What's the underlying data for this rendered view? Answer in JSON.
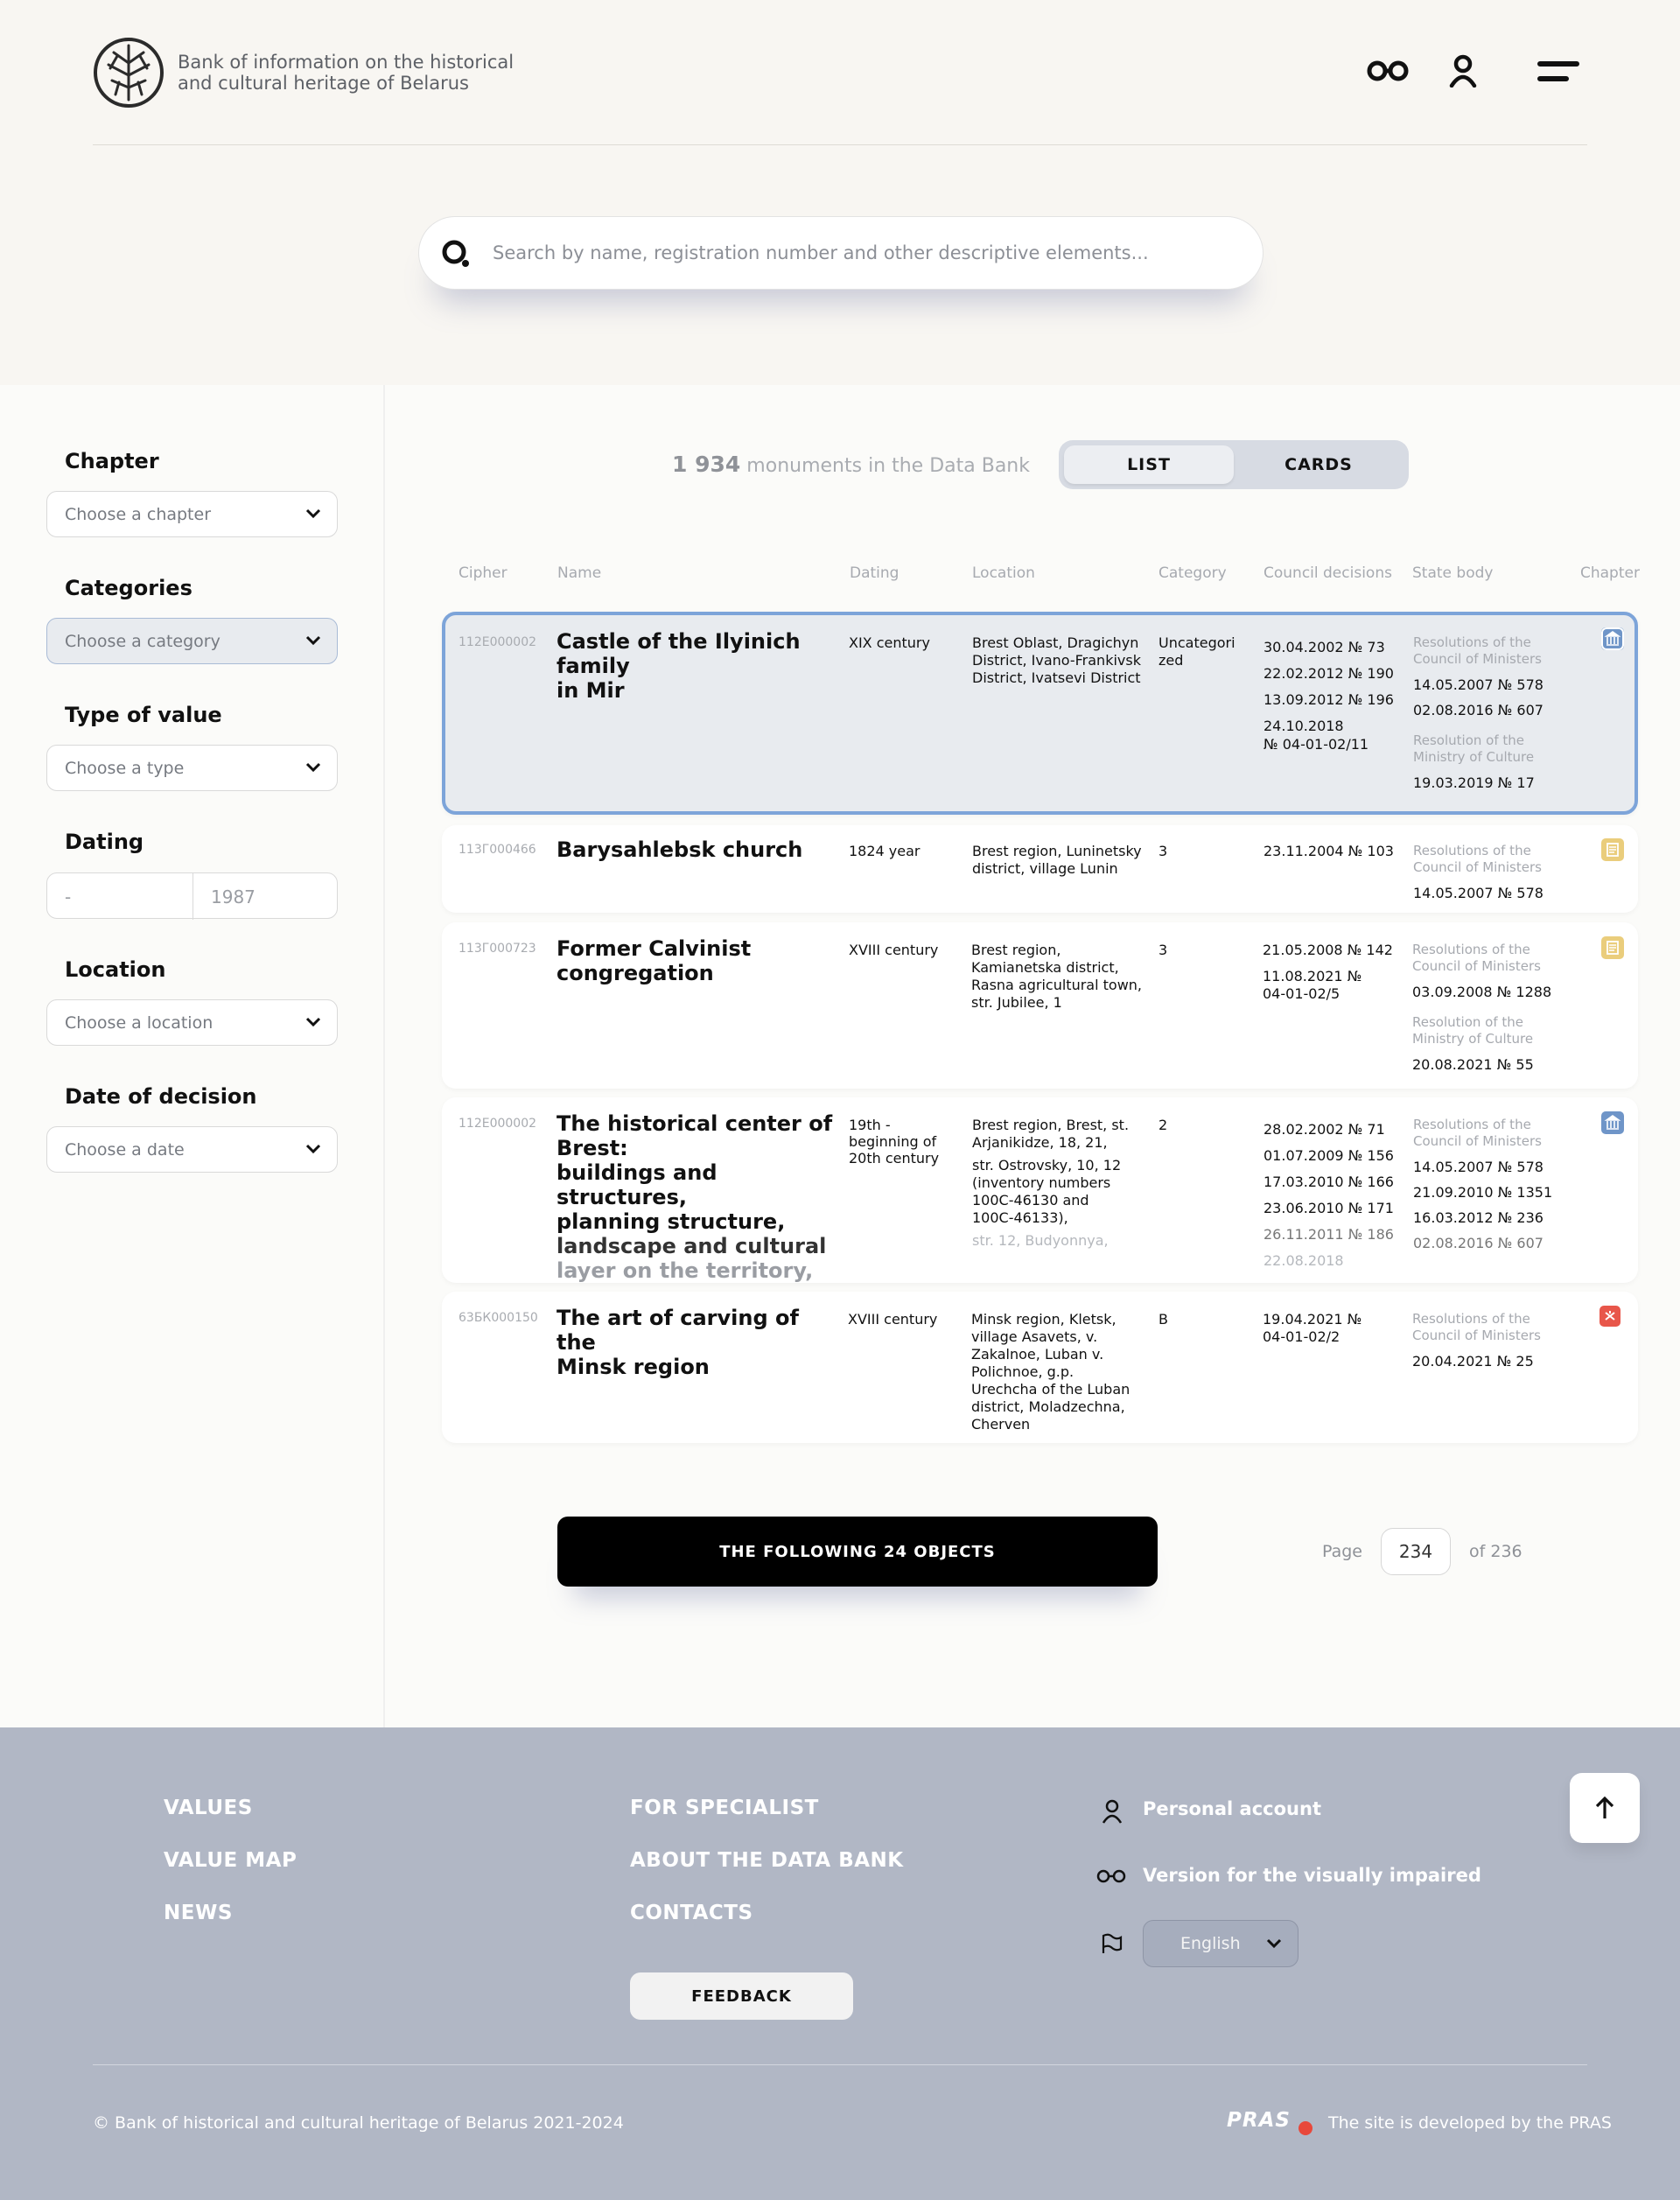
{
  "header": {
    "brand_line1": "Bank of information on the historical",
    "brand_line2": "and cultural heritage of Belarus",
    "icons": [
      "visually-impaired-icon",
      "user-icon",
      "menu-icon"
    ]
  },
  "search": {
    "placeholder": "Search by name, registration number and other descriptive elements..."
  },
  "filters": {
    "chapter": {
      "label": "Chapter",
      "placeholder": "Choose a chapter"
    },
    "categories": {
      "label": "Categories",
      "placeholder": "Choose a category"
    },
    "type": {
      "label": "Type of value",
      "placeholder": "Choose a type"
    },
    "dating": {
      "label": "Dating",
      "from": "-",
      "to": "1987"
    },
    "location": {
      "label": "Location",
      "placeholder": "Choose a location"
    },
    "decision": {
      "label": "Date of decision",
      "placeholder": "Choose a date"
    }
  },
  "summary": {
    "count": "1 934",
    "text": "monuments in the Data Bank"
  },
  "view_toggle": {
    "list": "LIST",
    "cards": "CARDS",
    "active": "LIST"
  },
  "table": {
    "headers": [
      "Cipher",
      "Name",
      "Dating",
      "Location",
      "Category",
      "Council decisions",
      "State body",
      "Chapter"
    ],
    "rows": [
      {
        "cipher": "112Е000002",
        "name": [
          "Castle of the Ilyinich family",
          "in Mir"
        ],
        "dating": "XIX century",
        "location": [
          "Brest Oblast, Dragichyn",
          "District, Ivano-Frankivsk",
          "District, Ivatsevi District"
        ],
        "category": [
          "Uncategori",
          "zed"
        ],
        "decisions": [
          "30.04.2002 № 73",
          "22.02.2012 № 190",
          "13.09.2012 № 196",
          "24.10.2018",
          "№ 04-01-02/11"
        ],
        "body1": [
          "Resolutions of the",
          "Council of Ministers"
        ],
        "body1_items": [
          "14.05.2007 № 578",
          "02.08.2016 № 607"
        ],
        "body2": [
          "Resolution of the",
          "Ministry of Culture"
        ],
        "body2_items": [
          "19.03.2019 № 17"
        ],
        "chapter_icon": "museum-icon",
        "chapter_color": "#6f95c8"
      },
      {
        "cipher": "113Г000466",
        "name": [
          "Barysahlebsk church"
        ],
        "dating": "1824 year",
        "location": [
          "Brest region, Luninetsky",
          "district, village Lunin"
        ],
        "category": [
          "3"
        ],
        "decisions": [
          "23.11.2004 № 103"
        ],
        "body1": [
          "Resolutions of the",
          "Council of Ministers"
        ],
        "body1_items": [
          "14.05.2007 № 578"
        ],
        "chapter_icon": "document-icon",
        "chapter_color": "#eacd7c"
      },
      {
        "cipher": "113Г000723",
        "name": [
          "Former Calvinist",
          "congregation"
        ],
        "dating": "XVIII century",
        "location": [
          "Brest region,",
          "Kamianetska district,",
          "Rasna agricultural town,",
          "str. Jubilee, 1"
        ],
        "category": [
          "3"
        ],
        "decisions": [
          "21.05.2008 № 142",
          "11.08.2021 №",
          "04-01-02/5"
        ],
        "body1": [
          "Resolutions of the",
          "Council of Ministers"
        ],
        "body1_items": [
          "03.09.2008 № 1288"
        ],
        "body2": [
          "Resolution of the",
          "Ministry of Culture"
        ],
        "body2_items": [
          "20.08.2021 № 55"
        ],
        "chapter_icon": "document-icon",
        "chapter_color": "#eacd7c"
      },
      {
        "cipher": "112Е000002",
        "name": [
          "The historical center of",
          "Brest:",
          "buildings and structures,",
          "planning structure,",
          "landscape and cultural",
          "layer on the territory,"
        ],
        "dating": "19th -\nbeginning of\n20th century",
        "location": [
          "Brest region, Brest, st.",
          "Arjanikidze, 18, 21,",
          "str. Ostrovsky, 10, 12",
          "(inventory numbers",
          "100С-46130 and",
          "100С-46133),",
          "str. 12, Budyonnya,"
        ],
        "category": [
          "2"
        ],
        "decisions": [
          "28.02.2002 № 71",
          "01.07.2009 № 156",
          "17.03.2010 № 166",
          "23.06.2010 № 171",
          "26.11.2011 № 186",
          "22.08.2018"
        ],
        "body1": [
          "Resolutions of the",
          "Council of Ministers"
        ],
        "body1_items": [
          "14.05.2007 № 578",
          "21.09.2010 № 1351",
          "16.03.2012 № 236",
          "02.08.2016 № 607"
        ],
        "chapter_icon": "museum-icon",
        "chapter_color": "#6f95c8"
      },
      {
        "cipher": "63БК000150",
        "name": [
          "The art of carving of the",
          "Minsk region"
        ],
        "dating": "XVIII century",
        "location": [
          "Minsk region, Kletsk,",
          "village Asavets, v.",
          "Zakalnoe, Luban v.",
          "Polichnoe, g.p.",
          "Urechcha of the Luban",
          "district, Moladzechna,",
          "Cherven"
        ],
        "category": [
          "B"
        ],
        "decisions": [
          "19.04.2021 №",
          "04-01-02/2"
        ],
        "body1": [
          "Resolutions of the",
          "Council of Ministers"
        ],
        "body1_items": [
          "20.04.2021 № 25"
        ],
        "chapter_icon": "intangible-icon",
        "chapter_color": "#e8564a"
      }
    ]
  },
  "pagination": {
    "next_label": "THE FOLLOWING 24 OBJECTS",
    "page_label": "Page",
    "page": "234",
    "of_label": "of 236"
  },
  "footer": {
    "col1": [
      "VALUES",
      "VALUE MAP",
      "NEWS"
    ],
    "col2": [
      "FOR SPECIALIST",
      "ABOUT THE DATA BANK",
      "CONTACTS"
    ],
    "feedback": "FEEDBACK",
    "personal": "Personal account",
    "impaired": "Version for the visually impaired",
    "language": "English",
    "copyright": "© Bank of historical and cultural heritage of Belarus 2021-2024",
    "pras": "PRAS",
    "developer": "The site is developed by the PRAS"
  }
}
